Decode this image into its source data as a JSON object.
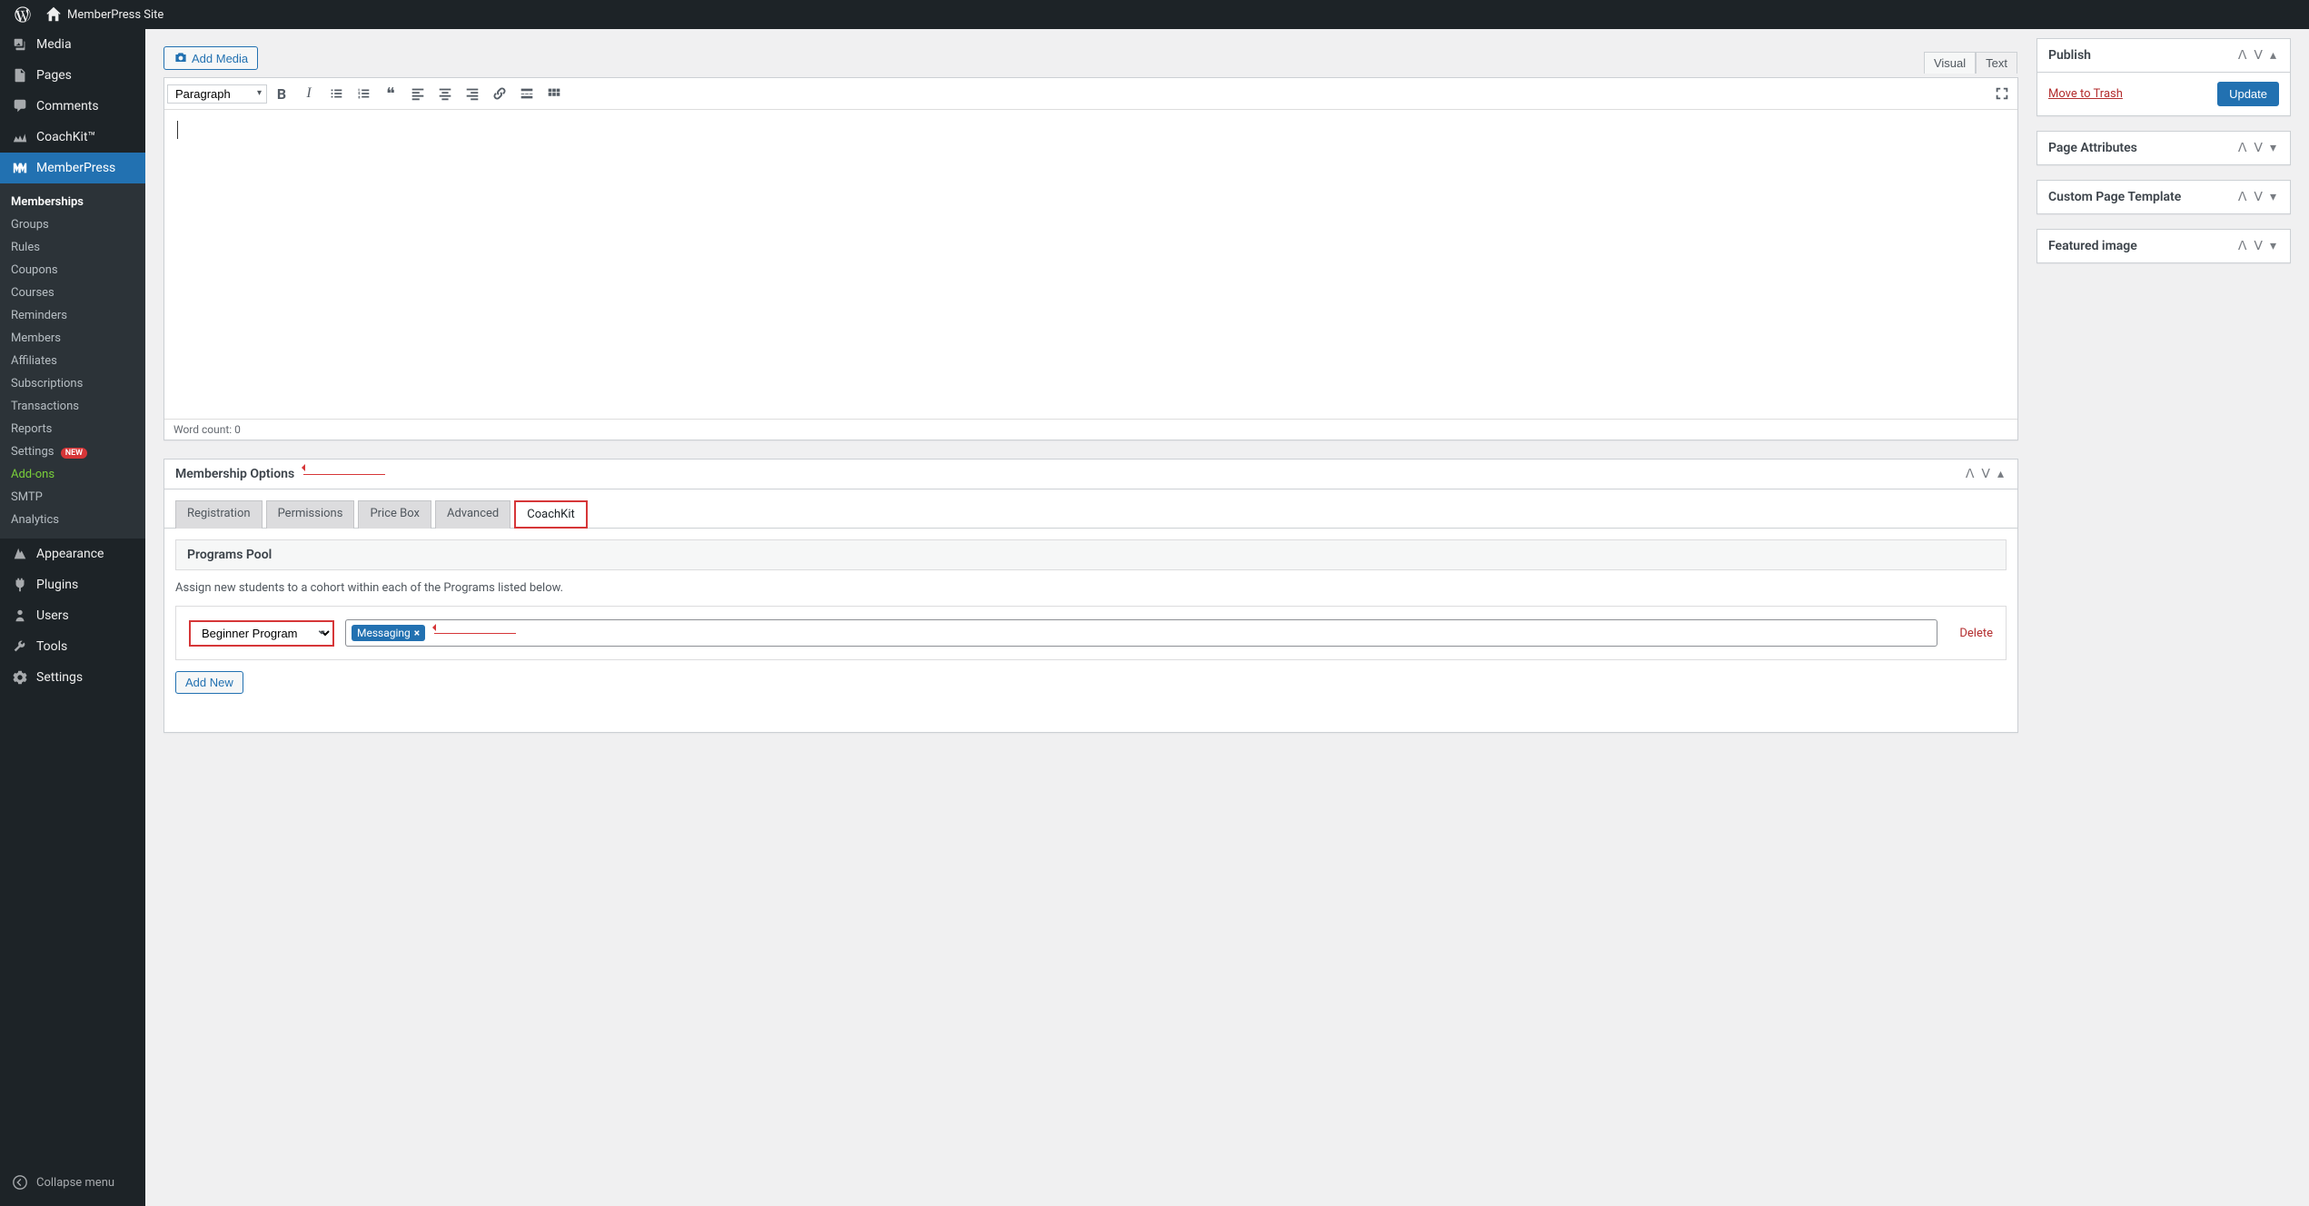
{
  "adminbar": {
    "site_title": "MemberPress Site"
  },
  "sidebar": {
    "media": "Media",
    "pages": "Pages",
    "comments": "Comments",
    "coachkit": "CoachKit™",
    "memberpress": "MemberPress",
    "submenu": {
      "memberships": "Memberships",
      "groups": "Groups",
      "rules": "Rules",
      "coupons": "Coupons",
      "courses": "Courses",
      "reminders": "Reminders",
      "members": "Members",
      "affiliates": "Affiliates",
      "subscriptions": "Subscriptions",
      "transactions": "Transactions",
      "reports": "Reports",
      "settings": "Settings",
      "settings_badge": "NEW",
      "addons": "Add-ons",
      "smtp": "SMTP",
      "analytics": "Analytics"
    },
    "appearance": "Appearance",
    "plugins": "Plugins",
    "users": "Users",
    "tools": "Tools",
    "settings_main": "Settings",
    "collapse": "Collapse menu"
  },
  "editor": {
    "add_media": "Add Media",
    "visual_tab": "Visual",
    "text_tab": "Text",
    "format_select": "Paragraph",
    "word_count": "Word count: 0"
  },
  "sidepanels": {
    "publish": "Publish",
    "trash": "Move to Trash",
    "update": "Update",
    "page_attributes": "Page Attributes",
    "custom_template": "Custom Page Template",
    "featured_image": "Featured image"
  },
  "options": {
    "title": "Membership Options",
    "tabs": {
      "registration": "Registration",
      "permissions": "Permissions",
      "price_box": "Price Box",
      "advanced": "Advanced",
      "coachkit": "CoachKit"
    },
    "section_title": "Programs Pool",
    "helper": "Assign new students to a cohort within each of the Programs listed below.",
    "program_select": "Beginner Program",
    "tag_label": "Messaging",
    "delete": "Delete",
    "add_new": "Add New"
  }
}
